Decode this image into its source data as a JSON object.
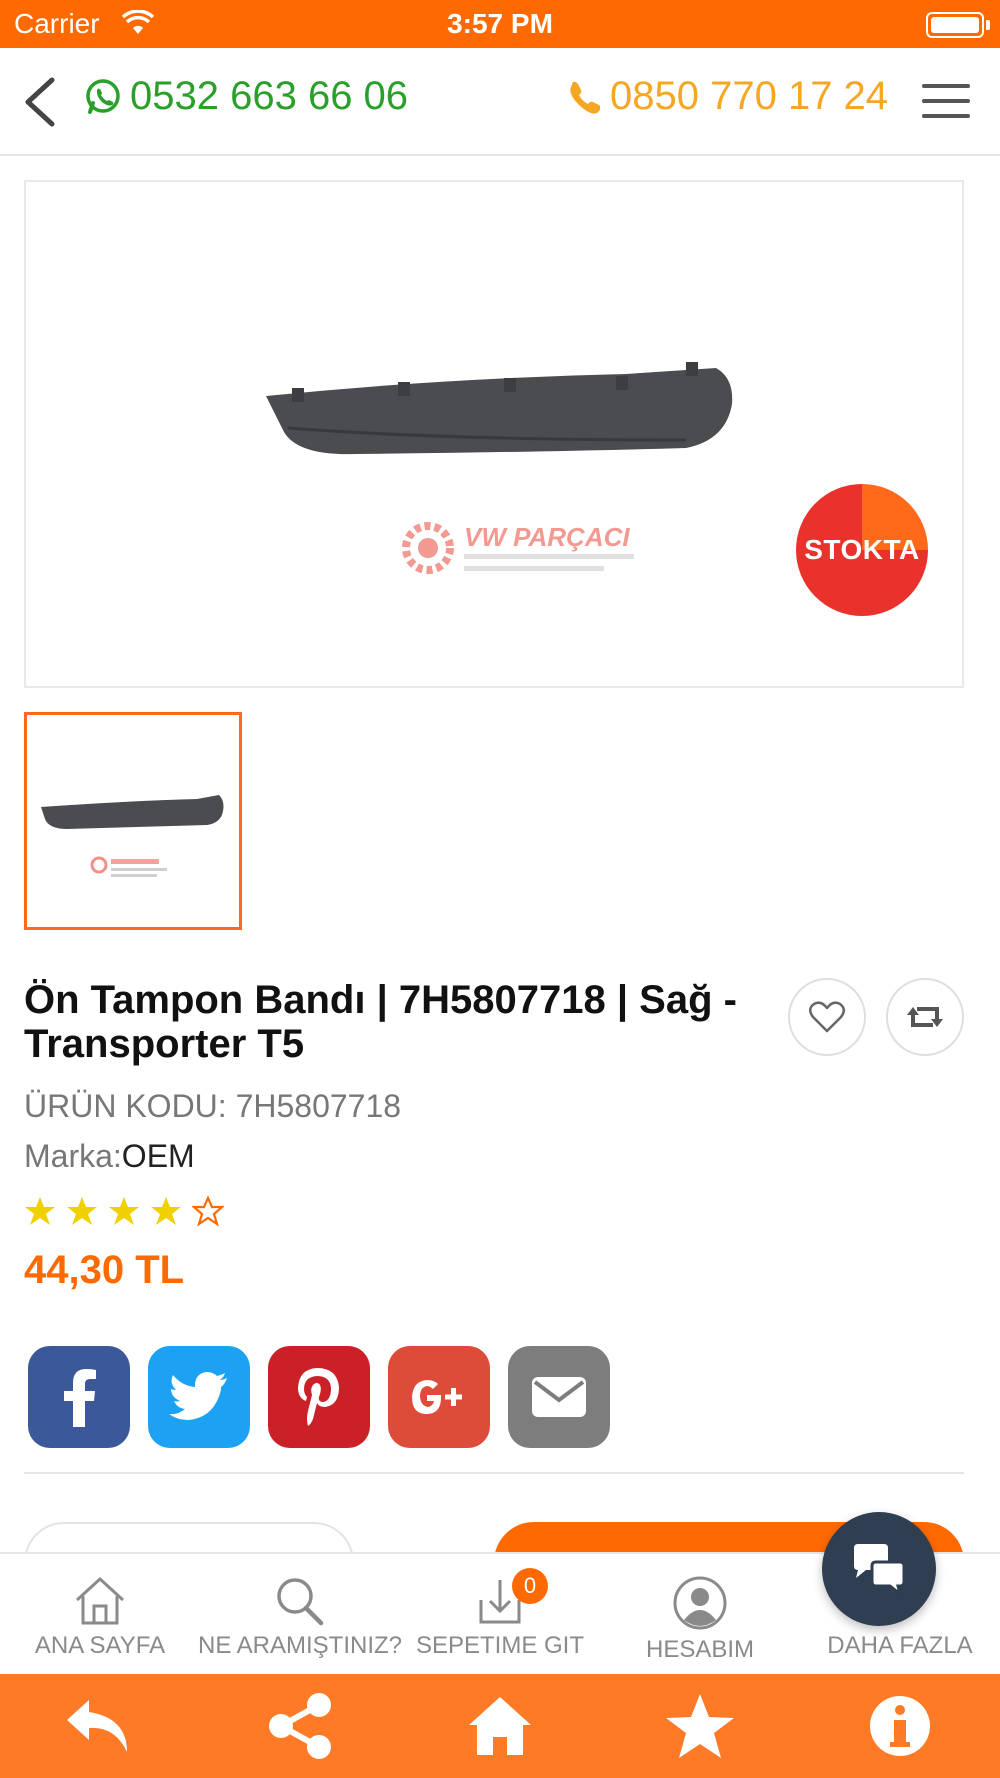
{
  "status_bar": {
    "carrier": "Carrier",
    "time": "3:57 PM"
  },
  "header": {
    "whatsapp_number": "0532 663 66 06",
    "phone_number": "0850 770 17 24"
  },
  "product": {
    "stock_badge": "STOKTA",
    "watermark_brand": "VW PARÇACI",
    "title": "Ön Tampon Bandı | 7H5807718 | Sağ - Transporter T5",
    "code_label": "ÜRÜN KODU: 7H5807718",
    "brand_label": "Marka:",
    "brand_value": "OEM",
    "rating": 4,
    "rating_max": 5,
    "price": "44,30 TL"
  },
  "social": [
    "facebook-icon",
    "twitter-icon",
    "pinterest-icon",
    "google-plus-icon",
    "mail-icon"
  ],
  "tabbar": {
    "home": "ANA SAYFA",
    "search": "NE ARAMIŞTINIZ?",
    "cart": "SEPETIME GIT",
    "cart_count": "0",
    "account": "HESABIM",
    "more": "DAHA FAZLA"
  },
  "colors": {
    "accent": "#ff6a00",
    "whatsapp": "#2aa02a",
    "phone": "#f5a623"
  }
}
